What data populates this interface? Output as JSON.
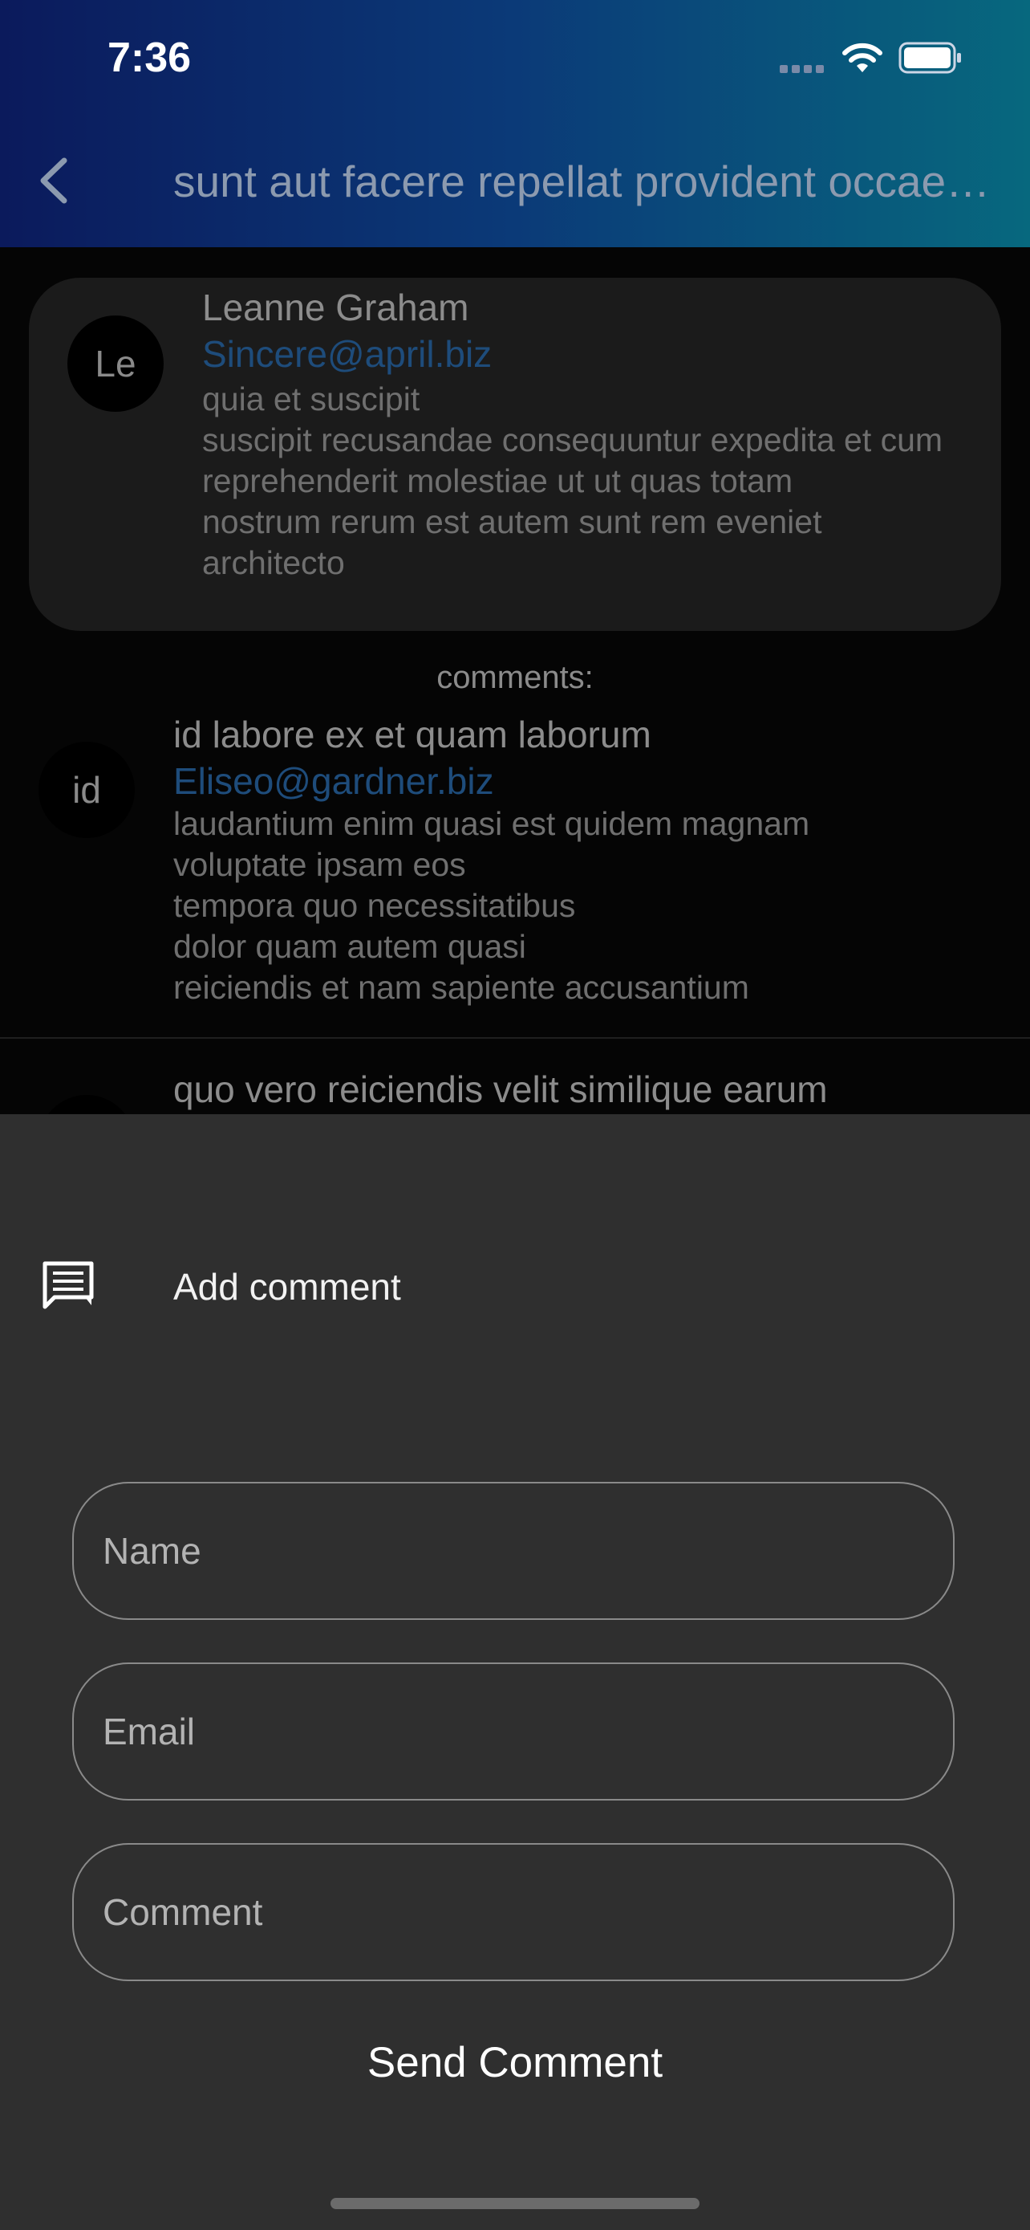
{
  "status_bar": {
    "time": "7:36"
  },
  "header": {
    "title": "sunt aut facere repellat provident occaecati excepturi optio reprehenderit"
  },
  "post": {
    "avatar": "Le",
    "name": "Leanne Graham",
    "email": "Sincere@april.biz",
    "body": "quia et suscipit\nsuscipit recusandae consequuntur expedita et cum\nreprehenderit molestiae ut ut quas totam\nnostrum rerum est autem sunt rem eveniet architecto"
  },
  "comments_heading": "comments:",
  "comments": [
    {
      "avatar": "id",
      "name": "id labore ex et quam laborum",
      "email": "Eliseo@gardner.biz",
      "body": "laudantium enim quasi est quidem magnam\nvoluptate ipsam eos\ntempora quo necessitatibus\ndolor quam autem quasi\nreiciendis et nam sapiente accusantium"
    },
    {
      "name": "quo vero reiciendis velit similique earum"
    }
  ],
  "sheet": {
    "title": "Add comment",
    "icon": "comment-icon",
    "name_placeholder": "Name",
    "email_placeholder": "Email",
    "comment_placeholder": "Comment",
    "send_label": "Send Comment"
  },
  "colors": {
    "header_gradient_start": "#0b1a5c",
    "header_gradient_end": "#07687e",
    "link": "#1e4c7b",
    "sheet_bg": "#2f2f2f"
  }
}
